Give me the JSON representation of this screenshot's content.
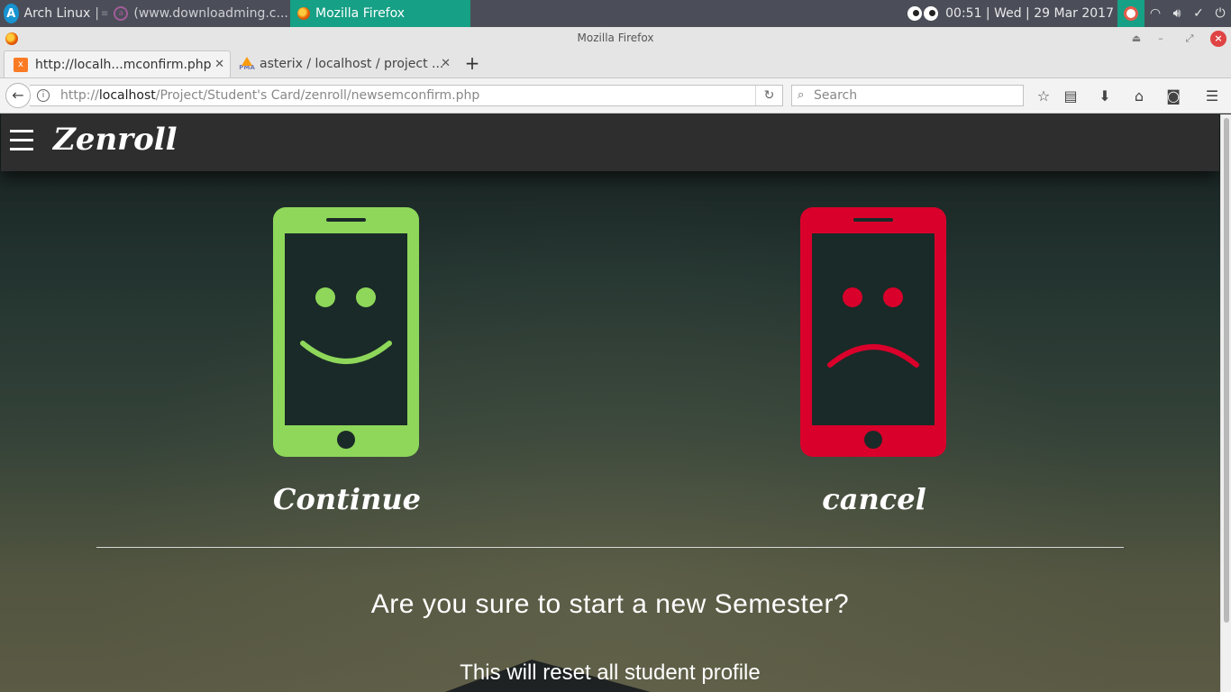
{
  "panel": {
    "arch_label": "Arch Linux",
    "arch_sep": "|",
    "task_download": "(www.downloadming.c...",
    "task_firefox": "Mozilla Firefox",
    "clock": "00:51  |  Wed  |  29 Mar 2017"
  },
  "window": {
    "title": "Mozilla Firefox"
  },
  "tabs": [
    {
      "label": "http://localh...mconfirm.php"
    },
    {
      "label": "asterix / localhost / project ..."
    }
  ],
  "navbar": {
    "url_prefix": "http://",
    "url_host": "localhost",
    "url_path": "/Project/Student's Card/zenroll/newsemconfirm.php",
    "search_placeholder": "Search"
  },
  "page": {
    "brand": "Zenroll",
    "continue_label": "Continue",
    "cancel_label": "cancel",
    "question": "Are you sure to start a new Semester?",
    "subtext": "This will reset all student profile"
  },
  "colors": {
    "ok_green": "#8ed75a",
    "cancel_red": "#d9002b",
    "panel_accent": "#16a085"
  }
}
